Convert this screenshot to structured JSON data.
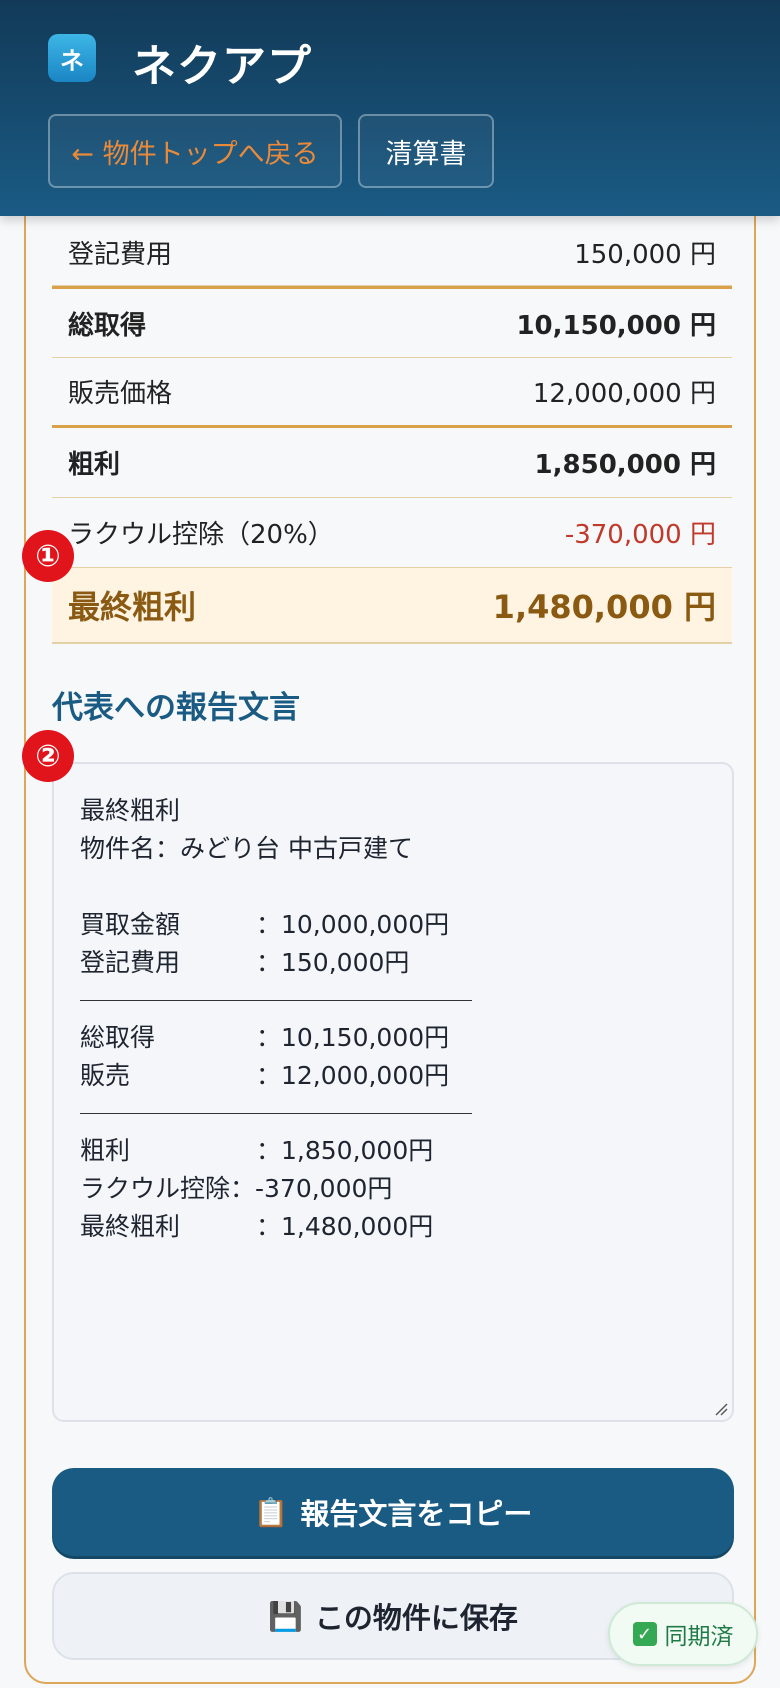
{
  "app": {
    "title": "ネクアプ",
    "logo_text": "ネ"
  },
  "header": {
    "back_label": "← 物件トップへ戻る",
    "sheet_label": "清算書"
  },
  "summary": {
    "rows": [
      {
        "label": "登記費用",
        "value": "150,000 円",
        "style": "normal"
      },
      {
        "label": "総取得",
        "value": "10,150,000 円",
        "style": "bold"
      },
      {
        "label": "販売価格",
        "value": "12,000,000 円",
        "style": "normal"
      },
      {
        "label": "粗利",
        "value": "1,850,000 円",
        "style": "bold"
      },
      {
        "label": "ラクウル控除（20%）",
        "value": "-370,000 円",
        "style": "negative"
      },
      {
        "label": "最終粗利",
        "value": "1,480,000 円",
        "style": "final"
      }
    ]
  },
  "badges": {
    "one": "①",
    "two": "②"
  },
  "report": {
    "title": "代表への報告文言",
    "heading": "最終粗利",
    "property": "物件名：みどり台 中古戸建て",
    "lines1": [
      {
        "label": "買取金額",
        "value": "：10,000,000円"
      },
      {
        "label": "登記費用",
        "value": "：150,000円"
      }
    ],
    "lines2": [
      {
        "label": "総取得",
        "value": "：10,150,000円"
      },
      {
        "label": "販売",
        "value": "：12,000,000円"
      }
    ],
    "lines3_a": {
      "label": "粗利",
      "value": "：1,850,000円"
    },
    "lines3_b": "ラクウル控除：-370,000円",
    "lines3_c": {
      "label": "最終粗利",
      "value": "：1,480,000円"
    }
  },
  "actions": {
    "copy_label": "報告文言をコピー",
    "save_label": "この物件に保存"
  },
  "sync": {
    "label": "同期済"
  },
  "colors": {
    "primary": "#1a5b84",
    "accent": "#dda75a",
    "negative": "#c0392b",
    "badge": "#e1131b"
  }
}
